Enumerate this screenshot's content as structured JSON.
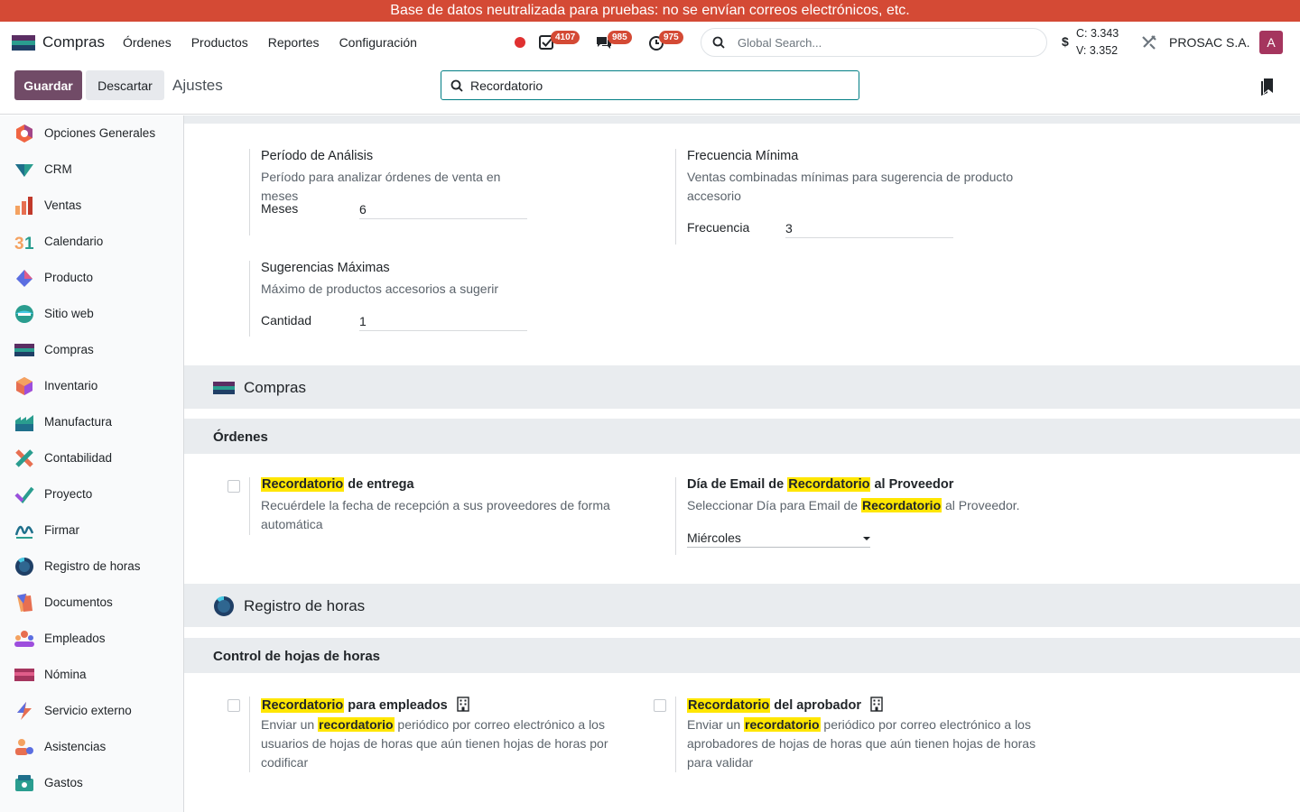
{
  "banner": "Base de datos neutralizada para pruebas: no se envían correos electrónicos, etc.",
  "navbar": {
    "app_name": "Compras",
    "menu": [
      "Órdenes",
      "Productos",
      "Reportes",
      "Configuración"
    ],
    "badges": {
      "activities": "4107",
      "messages": "985",
      "timesheets": "975"
    },
    "search_placeholder": "Global Search...",
    "currency_symbol": "$",
    "rate_c": "C: 3.343",
    "rate_v": "V: 3.352",
    "company": "PROSAC S.A.",
    "avatar_letter": "A",
    "colors": {
      "brand": "#714b67",
      "banner": "#d44a35",
      "avatar": "#a5355e",
      "highlight": "#ffe600"
    }
  },
  "control": {
    "save": "Guardar",
    "discard": "Descartar",
    "breadcrumb": "Ajustes",
    "search_value": "Recordatorio"
  },
  "sidebar": {
    "items": [
      {
        "label": "Opciones Generales",
        "icon": "settings-app-icon"
      },
      {
        "label": "CRM",
        "icon": "crm-app-icon"
      },
      {
        "label": "Ventas",
        "icon": "sales-app-icon"
      },
      {
        "label": "Calendario",
        "icon": "calendar-app-icon"
      },
      {
        "label": "Producto",
        "icon": "product-app-icon"
      },
      {
        "label": "Sitio web",
        "icon": "website-app-icon"
      },
      {
        "label": "Compras",
        "icon": "purchase-app-icon"
      },
      {
        "label": "Inventario",
        "icon": "inventory-app-icon"
      },
      {
        "label": "Manufactura",
        "icon": "manufacturing-app-icon"
      },
      {
        "label": "Contabilidad",
        "icon": "accounting-app-icon"
      },
      {
        "label": "Proyecto",
        "icon": "project-app-icon"
      },
      {
        "label": "Firmar",
        "icon": "sign-app-icon"
      },
      {
        "label": "Registro de horas",
        "icon": "timesheet-app-icon"
      },
      {
        "label": "Documentos",
        "icon": "documents-app-icon"
      },
      {
        "label": "Empleados",
        "icon": "employees-app-icon"
      },
      {
        "label": "Nómina",
        "icon": "payroll-app-icon"
      },
      {
        "label": "Servicio externo",
        "icon": "field-service-app-icon"
      },
      {
        "label": "Asistencias",
        "icon": "attendances-app-icon"
      },
      {
        "label": "Gastos",
        "icon": "expenses-app-icon"
      }
    ]
  },
  "sales_block": {
    "period": {
      "title": "Período de Análisis",
      "desc": "Período para analizar órdenes de venta en meses",
      "field_label": "Meses",
      "field_value": "6"
    },
    "frequency": {
      "title": "Frecuencia Mínima",
      "desc_1": "Ventas combinadas mínimas para sugerencia de producto",
      "desc_2": "accesorio",
      "field_label": "Frecuencia",
      "field_value": "3"
    },
    "max_suggest": {
      "title": "Sugerencias Máximas",
      "desc": "Máximo de productos accesorios a sugerir",
      "field_label": "Cantidad",
      "field_value": "1"
    }
  },
  "purchase": {
    "app_title": "Compras",
    "section": "Órdenes",
    "hl": "Recordatorio",
    "receipt": {
      "title_rest": " de entrega",
      "desc_1": "Recuérdele la fecha de recepción a sus proveedores de forma",
      "desc_2": "automática"
    },
    "email_day": {
      "title_pre": "Día de Email de ",
      "title_post": " al Proveedor",
      "desc_pre": "Seleccionar Día para Email de ",
      "desc_post": " al Proveedor.",
      "select_value": "Miércoles"
    }
  },
  "timesheet": {
    "app_title": "Registro de horas",
    "section": "Control de hojas de horas",
    "hl_title": "Recordatorio",
    "hl_desc": "recordatorio",
    "employees": {
      "title_rest": " para empleados",
      "desc_pre": "Enviar un ",
      "desc_post": " periódico por correo electrónico a los",
      "desc_2": "usuarios de hojas de horas que aún tienen hojas de horas por",
      "desc_3": "codificar"
    },
    "approver": {
      "title_rest": " del aprobador",
      "desc_pre": "Enviar un ",
      "desc_post": " periódico por correo electrónico a los",
      "desc_2": "aprobadores de hojas de horas que aún tienen hojas de horas",
      "desc_3": "para validar"
    }
  }
}
